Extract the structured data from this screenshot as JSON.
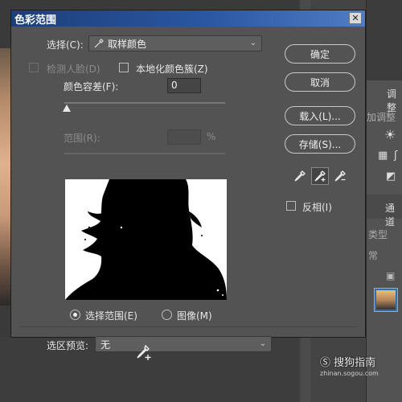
{
  "dialog": {
    "title": "色彩范围",
    "close_label": "✕",
    "select_label": "选择(C):",
    "select_value": "取样颜色",
    "detect_faces_label": "检测人脸(D)",
    "localized_label": "本地化颜色簇(Z)",
    "fuzziness_label": "颜色容差(F):",
    "fuzziness_value": "0",
    "range_label": "范围(R):",
    "range_value": "",
    "range_unit": "%",
    "radio_selection_label": "选择范围(E)",
    "radio_image_label": "图像(M)",
    "preview_label": "选区预览:",
    "preview_value": "无",
    "ok_label": "确定",
    "cancel_label": "取消",
    "load_label": "载入(L)...",
    "save_label": "存储(S)...",
    "invert_label": "反相(I)",
    "icons": [
      "eyedropper-icon",
      "eyedropper-plus-icon",
      "eyedropper-minus-icon",
      "close-icon",
      "chevron-down-icon"
    ]
  },
  "right_panel": {
    "tab_adjust": "调整",
    "add_adjust": "加调整",
    "tab_channels": "通道",
    "filter_type": "类型",
    "blend_normal": "常"
  },
  "watermark": {
    "brand": "搜狗指南",
    "url": "zhinan.sogou.com"
  },
  "colors": {
    "title_bar": "#2a56a2",
    "dialog_bg": "#535353",
    "mask_white": "#ffffff",
    "mask_black": "#000000"
  }
}
